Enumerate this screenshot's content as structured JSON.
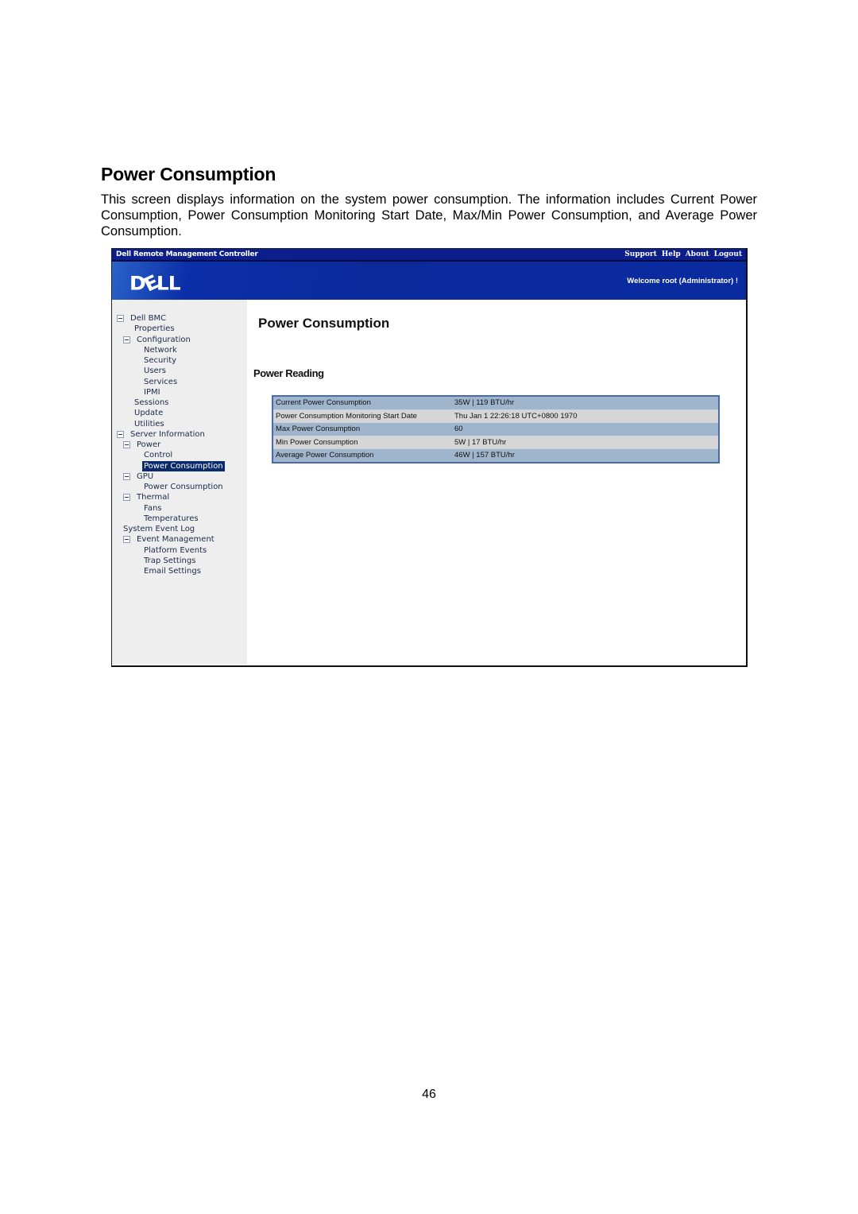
{
  "document": {
    "heading": "Power Consumption",
    "paragraph": "This screen displays information on the system power consumption. The information includes Current Power Consumption, Power Consumption Monitoring Start Date, Max/Min Power Consumption, and Average Power Consumption.",
    "page_number": "46"
  },
  "app": {
    "title": "Dell Remote Management Controller",
    "top_links": [
      "Support",
      "Help",
      "About",
      "Logout"
    ],
    "logo": {
      "d": "D",
      "e": "E",
      "ll": "LL"
    },
    "welcome": "Welcome root (Administrator) !",
    "colors": {
      "topbar": "#0c1e8c",
      "banner": "#0a2a9c",
      "selected": "#0a2a6e",
      "table_border": "#4a6ab0",
      "row_odd": "#9fb5cc",
      "row_even": "#d6d6d6"
    }
  },
  "sidebar": {
    "items": [
      {
        "label": "Dell BMC",
        "level": 0,
        "toggle": true
      },
      {
        "label": "Properties",
        "level": 1,
        "toggle": false
      },
      {
        "label": "Configuration",
        "level": 1,
        "toggle": true
      },
      {
        "label": "Network",
        "level": 2,
        "toggle": false
      },
      {
        "label": "Security",
        "level": 2,
        "toggle": false
      },
      {
        "label": "Users",
        "level": 2,
        "toggle": false
      },
      {
        "label": "Services",
        "level": 2,
        "toggle": false
      },
      {
        "label": "IPMI",
        "level": 2,
        "toggle": false
      },
      {
        "label": "Sessions",
        "level": 1,
        "toggle": false
      },
      {
        "label": "Update",
        "level": 1,
        "toggle": false
      },
      {
        "label": "Utilities",
        "level": 1,
        "toggle": false
      },
      {
        "label": "Server Information",
        "level": 0,
        "toggle": true
      },
      {
        "label": "Power",
        "level": 1,
        "toggle": true
      },
      {
        "label": "Control",
        "level": 2,
        "toggle": false
      },
      {
        "label": "Power Consumption",
        "level": 2,
        "toggle": false,
        "selected": true
      },
      {
        "label": "GPU",
        "level": 1,
        "toggle": true
      },
      {
        "label": "Power Consumption",
        "level": 2,
        "toggle": false
      },
      {
        "label": "Thermal",
        "level": 1,
        "toggle": true
      },
      {
        "label": "Fans",
        "level": 2,
        "toggle": false
      },
      {
        "label": "Temperatures",
        "level": 2,
        "toggle": false
      },
      {
        "label": "System Event Log",
        "level": 0,
        "toggle": false
      },
      {
        "label": "Event Management",
        "level": 1,
        "toggle": true
      },
      {
        "label": "Platform Events",
        "level": 2,
        "toggle": false
      },
      {
        "label": "Trap Settings",
        "level": 2,
        "toggle": false
      },
      {
        "label": "Email Settings",
        "level": 2,
        "toggle": false
      }
    ]
  },
  "main": {
    "title": "Power Consumption",
    "section": "Power Reading",
    "rows": [
      {
        "label": "Current Power Consumption",
        "value": "35W | 119 BTU/hr"
      },
      {
        "label": "Power Consumption Monitoring Start Date",
        "value": "Thu Jan 1 22:26:18 UTC+0800 1970"
      },
      {
        "label": "Max Power Consumption",
        "value": "60"
      },
      {
        "label": "Min Power Consumption",
        "value": "5W | 17 BTU/hr"
      },
      {
        "label": "Average Power Consumption",
        "value": "46W | 157 BTU/hr"
      }
    ]
  }
}
